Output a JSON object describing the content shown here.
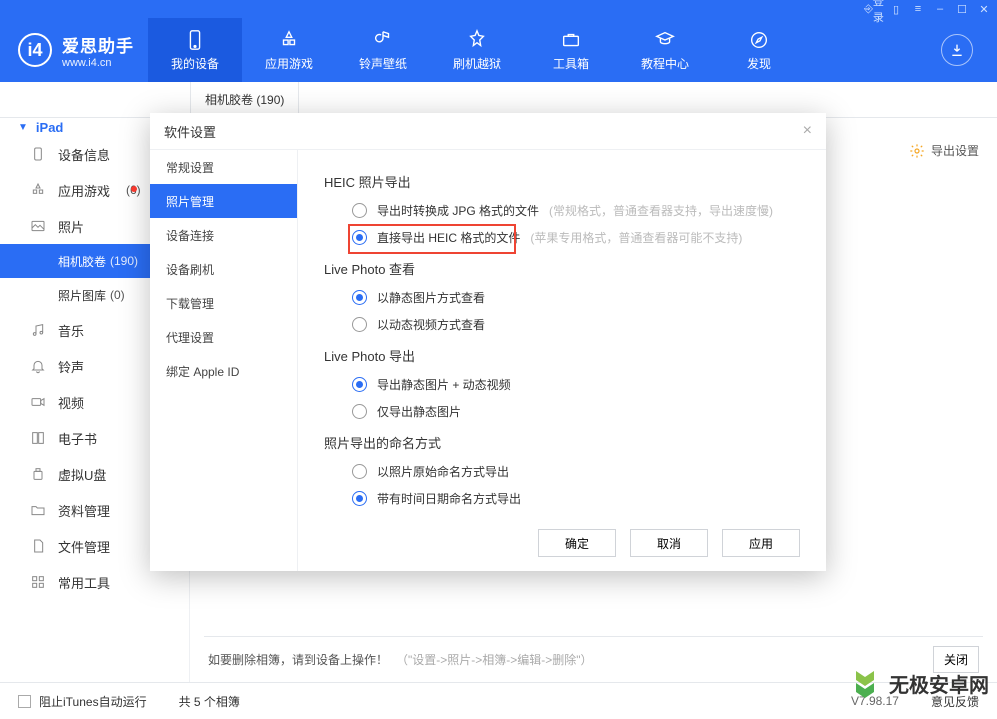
{
  "titlebar": {
    "login": "登录"
  },
  "brand": {
    "name": "爱思助手",
    "site": "www.i4.cn",
    "logo_letter": "i4"
  },
  "topnav": [
    {
      "key": "device",
      "label": "我的设备"
    },
    {
      "key": "apps",
      "label": "应用游戏"
    },
    {
      "key": "ring",
      "label": "铃声壁纸"
    },
    {
      "key": "flash",
      "label": "刷机越狱"
    },
    {
      "key": "tools",
      "label": "工具箱"
    },
    {
      "key": "tutorial",
      "label": "教程中心"
    },
    {
      "key": "discover",
      "label": "发现"
    }
  ],
  "subheader": {
    "camera_roll": "相机胶卷",
    "camera_roll_count": "(190)"
  },
  "sidebar": {
    "device": "iPad",
    "items": [
      {
        "key": "info",
        "label": "设备信息"
      },
      {
        "key": "apps",
        "label": "应用游戏",
        "count": "(6)",
        "dot": true
      },
      {
        "key": "photos",
        "label": "照片"
      },
      {
        "key": "music",
        "label": "音乐"
      },
      {
        "key": "ring",
        "label": "铃声"
      },
      {
        "key": "video",
        "label": "视频"
      },
      {
        "key": "ebook",
        "label": "电子书"
      },
      {
        "key": "udisk",
        "label": "虚拟U盘"
      },
      {
        "key": "datamgr",
        "label": "资料管理"
      },
      {
        "key": "filemgr",
        "label": "文件管理"
      },
      {
        "key": "commontools",
        "label": "常用工具"
      }
    ],
    "photo_subs": [
      {
        "key": "cameraroll",
        "label": "相机胶卷",
        "count": "(190)"
      },
      {
        "key": "library",
        "label": "照片图库",
        "count": "(0)"
      }
    ]
  },
  "export_settings": "导出设置",
  "hint": {
    "text": "如要删除相簿，请到设备上操作！",
    "gray": "（\"设置->照片->相簿->编辑->删除\"）",
    "close": "关闭"
  },
  "footer": {
    "block_itunes": "阻止iTunes自动运行",
    "albums": "共 5 个相簿",
    "version": "V7.98.17",
    "feedback": "意见反馈"
  },
  "modal": {
    "title": "软件设置",
    "side": [
      {
        "key": "general",
        "label": "常规设置"
      },
      {
        "key": "photo",
        "label": "照片管理"
      },
      {
        "key": "conn",
        "label": "设备连接"
      },
      {
        "key": "devflash",
        "label": "设备刷机"
      },
      {
        "key": "download",
        "label": "下载管理"
      },
      {
        "key": "proxy",
        "label": "代理设置"
      },
      {
        "key": "appleid",
        "label": "绑定 Apple ID"
      }
    ],
    "sections": {
      "heic": {
        "title": "HEIC 照片导出",
        "opt1": "导出时转换成 JPG 格式的文件",
        "opt1_note": "(常规格式，普通查看器支持，导出速度慢)",
        "opt2": "直接导出 HEIC 格式的文件",
        "opt2_note": "(苹果专用格式，普通查看器可能不支持)"
      },
      "live_view": {
        "title": "Live Photo 查看",
        "opt1": "以静态图片方式查看",
        "opt2": "以动态视频方式查看"
      },
      "live_export": {
        "title": "Live Photo 导出",
        "opt1": "导出静态图片 + 动态视频",
        "opt2": "仅导出静态图片"
      },
      "naming": {
        "title": "照片导出的命名方式",
        "opt1": "以照片原始命名方式导出",
        "opt2": "带有时间日期命名方式导出"
      }
    },
    "buttons": {
      "ok": "确定",
      "cancel": "取消",
      "apply": "应用"
    }
  },
  "watermark": "无极安卓网"
}
